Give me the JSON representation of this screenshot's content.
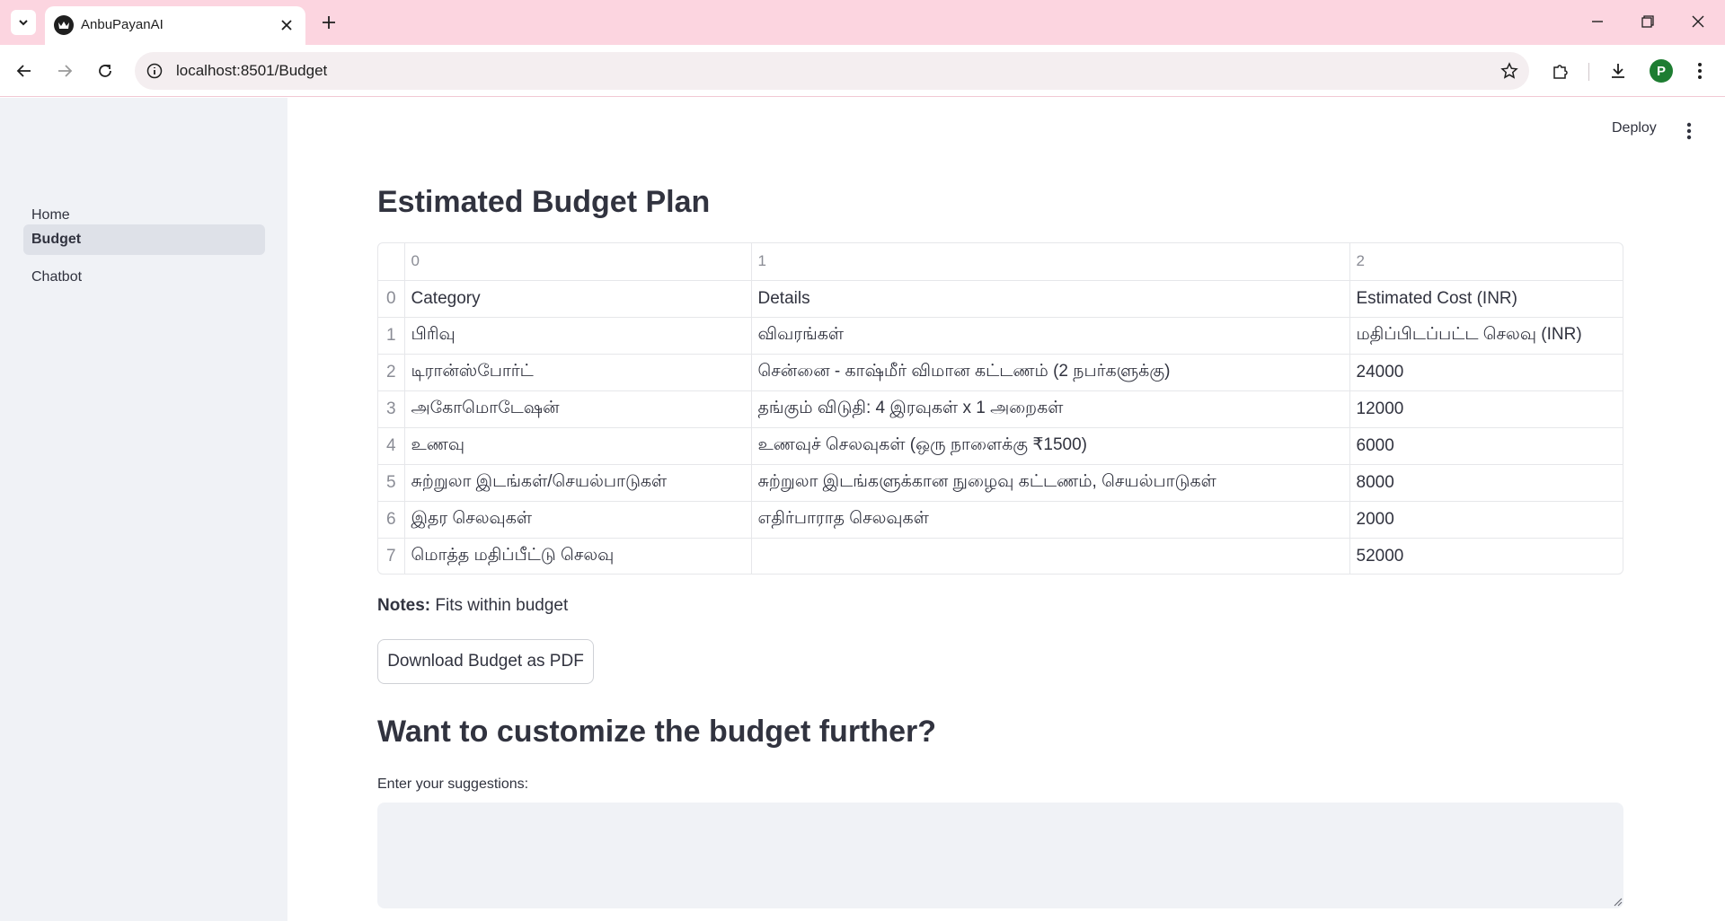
{
  "browser": {
    "tab_title": "AnbuPayanAI",
    "url": "localhost:8501/Budget",
    "profile_initial": "P"
  },
  "sidebar": {
    "items": [
      {
        "label": "Home",
        "active": false
      },
      {
        "label": "Budget",
        "active": true
      },
      {
        "label": "Chatbot",
        "active": false
      }
    ]
  },
  "header": {
    "deploy_label": "Deploy"
  },
  "main": {
    "title": "Estimated Budget Plan",
    "table": {
      "columns": [
        "0",
        "1",
        "2"
      ],
      "rows": [
        {
          "index": "0",
          "cells": [
            "Category",
            "Details",
            "Estimated Cost (INR)"
          ]
        },
        {
          "index": "1",
          "cells": [
            "பிரிவு",
            "விவரங்கள்",
            "மதிப்பிடப்பட்ட செலவு (INR)"
          ]
        },
        {
          "index": "2",
          "cells": [
            "டிரான்ஸ்போர்ட்",
            "சென்னை - காஷ்மீர் விமான கட்டணம் (2 நபர்களுக்கு)",
            "24000"
          ]
        },
        {
          "index": "3",
          "cells": [
            "அகோமொடேஷன்",
            "தங்கும் விடுதி: 4 இரவுகள் x 1 அறைகள்",
            "12000"
          ]
        },
        {
          "index": "4",
          "cells": [
            "உணவு",
            "உணவுச் செலவுகள் (ஒரு நாளைக்கு ₹1500)",
            "6000"
          ]
        },
        {
          "index": "5",
          "cells": [
            "சுற்றுலா இடங்கள்/செயல்பாடுகள்",
            "சுற்றுலா இடங்களுக்கான நுழைவு கட்டணம், செயல்பாடுகள்",
            "8000"
          ]
        },
        {
          "index": "6",
          "cells": [
            "இதர செலவுகள்",
            "எதிர்பாராத செலவுகள்",
            "2000"
          ]
        },
        {
          "index": "7",
          "cells": [
            "மொத்த மதிப்பீட்டு செலவு",
            "",
            "52000"
          ]
        }
      ]
    },
    "notes_label": "Notes:",
    "notes_text": " Fits within budget",
    "download_button": "Download Budget as PDF",
    "customize_title": "Want to customize the budget further?",
    "suggestions_label": "Enter your suggestions:",
    "suggestions_value": ""
  }
}
